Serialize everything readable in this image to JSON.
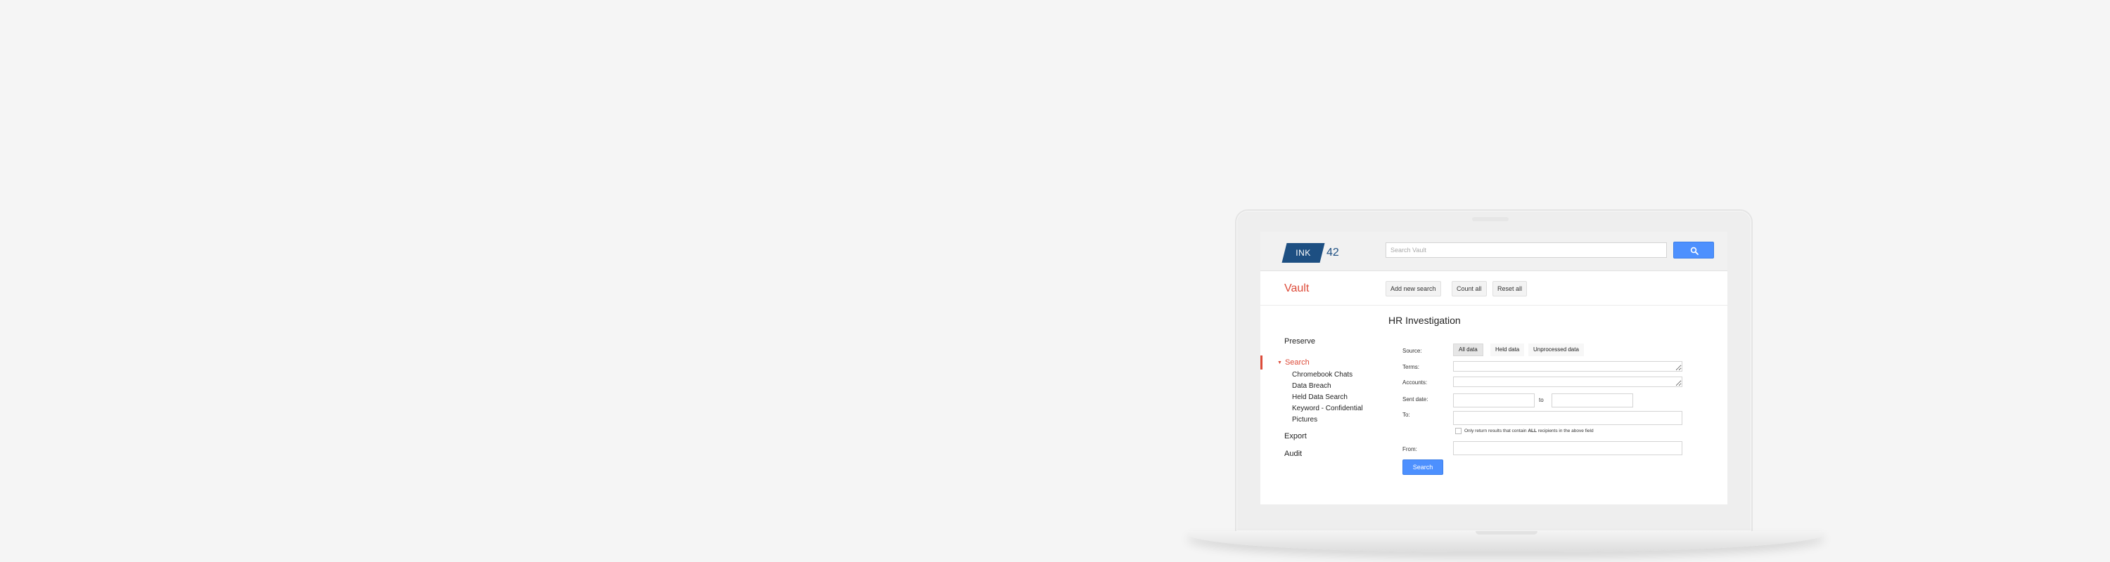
{
  "header": {
    "logo_text": "INK",
    "logo_number": "42",
    "search_placeholder": "Search Vault",
    "search_button_icon": "search-icon"
  },
  "app": {
    "title": "Vault",
    "actions": [
      "Add new search",
      "Count all",
      "Reset all"
    ]
  },
  "page": {
    "title": "HR Investigation"
  },
  "sidebar": {
    "preserve": "Preserve",
    "search": "Search",
    "search_children": [
      "Chromebook Chats",
      "Data Breach",
      "Held Data Search",
      "Keyword - Confidential",
      "Pictures"
    ],
    "export": "Export",
    "audit": "Audit"
  },
  "form": {
    "source_label": "Source:",
    "source_options": [
      "All data",
      "Held data",
      "Unprocessed data"
    ],
    "source_selected": "All data",
    "terms_label": "Terms:",
    "accounts_label": "Accounts:",
    "sent_date_label": "Sent date:",
    "to_separator": "to",
    "to_label": "To:",
    "checkbox_prefix": "Only return results that contain",
    "checkbox_bold": "ALL",
    "checkbox_suffix": "recipients in the above field",
    "from_label": "From:",
    "submit_label": "Search"
  },
  "colors": {
    "accent_red": "#dd4b39",
    "primary_blue": "#4d90fe",
    "logo_blue": "#1d4f82"
  }
}
